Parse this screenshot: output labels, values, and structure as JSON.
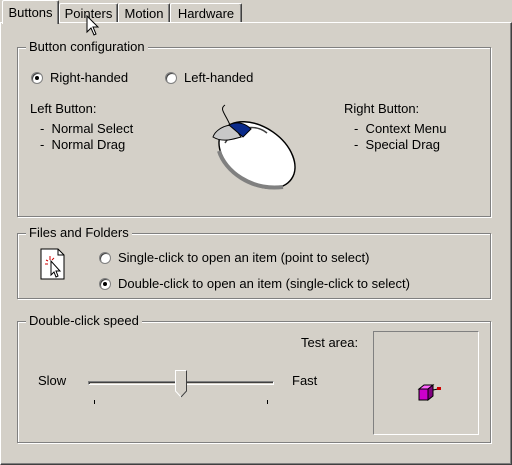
{
  "tabs": [
    {
      "label": "Buttons",
      "active": true
    },
    {
      "label": "Pointers",
      "active": false
    },
    {
      "label": "Motion",
      "active": false
    },
    {
      "label": "Hardware",
      "active": false
    }
  ],
  "button_config": {
    "title": "Button configuration",
    "right_handed": {
      "label": "Right-handed",
      "checked": true
    },
    "left_handed": {
      "label": "Left-handed",
      "checked": false
    },
    "left_button": {
      "heading": "Left Button:",
      "items": [
        "-  Normal Select",
        "-  Normal Drag"
      ]
    },
    "right_button": {
      "heading": "Right Button:",
      "items": [
        "-  Context Menu",
        "-  Special Drag"
      ]
    }
  },
  "files_folders": {
    "title": "Files and Folders",
    "single_click": {
      "label": "Single-click to open an item (point to select)",
      "checked": false
    },
    "double_click": {
      "label": "Double-click to open an item (single-click to select)",
      "checked": true
    }
  },
  "double_click_speed": {
    "title": "Double-click speed",
    "slow_label": "Slow",
    "fast_label": "Fast",
    "test_area_label": "Test area:",
    "slider_value": 0.5
  },
  "colors": {
    "face": "#d4d0c8",
    "shadow": "#808080",
    "highlight": "#ffffff",
    "test_box": "#cc00cc"
  }
}
